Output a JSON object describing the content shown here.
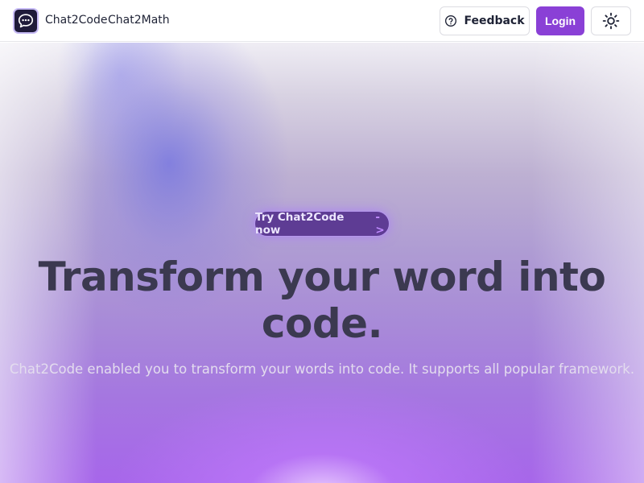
{
  "header": {
    "logo_icon": "chat-bubble-icon",
    "nav": [
      {
        "label": "Chat2Code"
      },
      {
        "label": "Chat2Math"
      }
    ],
    "feedback_label": "Feedback",
    "feedback_icon": "help-circle-icon",
    "login_label": "Login",
    "theme_icon": "sun-icon"
  },
  "hero": {
    "cta_label": "Try Chat2Code now",
    "cta_arrow": "->",
    "headline": "Transform your word into code.",
    "subtitle": "Chat2Code enabled you to transform your words into code. It supports all popular framework."
  },
  "colors": {
    "accent": "#8a40d6",
    "headline": "#3b3950",
    "cta_bg": "#5e3c94"
  }
}
